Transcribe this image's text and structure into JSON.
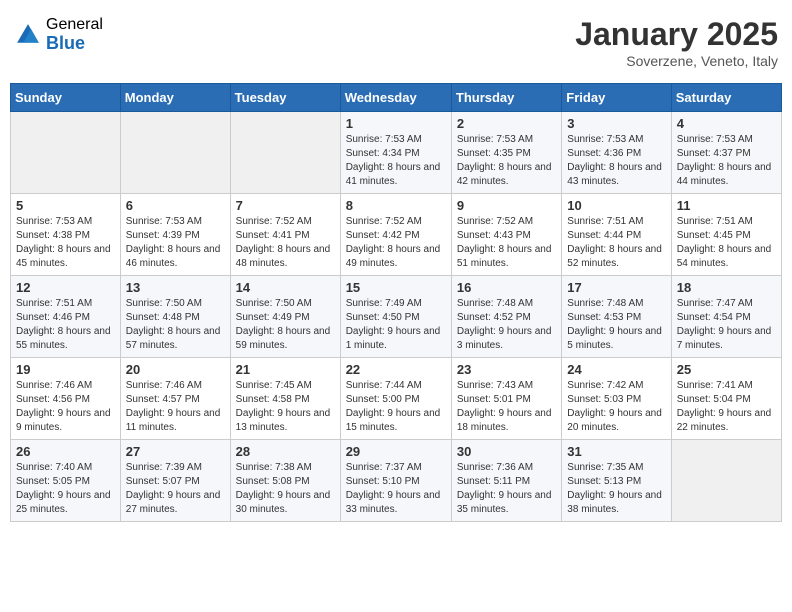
{
  "header": {
    "logo_general": "General",
    "logo_blue": "Blue",
    "month_title": "January 2025",
    "location": "Soverzene, Veneto, Italy"
  },
  "weekdays": [
    "Sunday",
    "Monday",
    "Tuesday",
    "Wednesday",
    "Thursday",
    "Friday",
    "Saturday"
  ],
  "weeks": [
    [
      {
        "day": "",
        "info": ""
      },
      {
        "day": "",
        "info": ""
      },
      {
        "day": "",
        "info": ""
      },
      {
        "day": "1",
        "info": "Sunrise: 7:53 AM\nSunset: 4:34 PM\nDaylight: 8 hours and 41 minutes."
      },
      {
        "day": "2",
        "info": "Sunrise: 7:53 AM\nSunset: 4:35 PM\nDaylight: 8 hours and 42 minutes."
      },
      {
        "day": "3",
        "info": "Sunrise: 7:53 AM\nSunset: 4:36 PM\nDaylight: 8 hours and 43 minutes."
      },
      {
        "day": "4",
        "info": "Sunrise: 7:53 AM\nSunset: 4:37 PM\nDaylight: 8 hours and 44 minutes."
      }
    ],
    [
      {
        "day": "5",
        "info": "Sunrise: 7:53 AM\nSunset: 4:38 PM\nDaylight: 8 hours and 45 minutes."
      },
      {
        "day": "6",
        "info": "Sunrise: 7:53 AM\nSunset: 4:39 PM\nDaylight: 8 hours and 46 minutes."
      },
      {
        "day": "7",
        "info": "Sunrise: 7:52 AM\nSunset: 4:41 PM\nDaylight: 8 hours and 48 minutes."
      },
      {
        "day": "8",
        "info": "Sunrise: 7:52 AM\nSunset: 4:42 PM\nDaylight: 8 hours and 49 minutes."
      },
      {
        "day": "9",
        "info": "Sunrise: 7:52 AM\nSunset: 4:43 PM\nDaylight: 8 hours and 51 minutes."
      },
      {
        "day": "10",
        "info": "Sunrise: 7:51 AM\nSunset: 4:44 PM\nDaylight: 8 hours and 52 minutes."
      },
      {
        "day": "11",
        "info": "Sunrise: 7:51 AM\nSunset: 4:45 PM\nDaylight: 8 hours and 54 minutes."
      }
    ],
    [
      {
        "day": "12",
        "info": "Sunrise: 7:51 AM\nSunset: 4:46 PM\nDaylight: 8 hours and 55 minutes."
      },
      {
        "day": "13",
        "info": "Sunrise: 7:50 AM\nSunset: 4:48 PM\nDaylight: 8 hours and 57 minutes."
      },
      {
        "day": "14",
        "info": "Sunrise: 7:50 AM\nSunset: 4:49 PM\nDaylight: 8 hours and 59 minutes."
      },
      {
        "day": "15",
        "info": "Sunrise: 7:49 AM\nSunset: 4:50 PM\nDaylight: 9 hours and 1 minute."
      },
      {
        "day": "16",
        "info": "Sunrise: 7:48 AM\nSunset: 4:52 PM\nDaylight: 9 hours and 3 minutes."
      },
      {
        "day": "17",
        "info": "Sunrise: 7:48 AM\nSunset: 4:53 PM\nDaylight: 9 hours and 5 minutes."
      },
      {
        "day": "18",
        "info": "Sunrise: 7:47 AM\nSunset: 4:54 PM\nDaylight: 9 hours and 7 minutes."
      }
    ],
    [
      {
        "day": "19",
        "info": "Sunrise: 7:46 AM\nSunset: 4:56 PM\nDaylight: 9 hours and 9 minutes."
      },
      {
        "day": "20",
        "info": "Sunrise: 7:46 AM\nSunset: 4:57 PM\nDaylight: 9 hours and 11 minutes."
      },
      {
        "day": "21",
        "info": "Sunrise: 7:45 AM\nSunset: 4:58 PM\nDaylight: 9 hours and 13 minutes."
      },
      {
        "day": "22",
        "info": "Sunrise: 7:44 AM\nSunset: 5:00 PM\nDaylight: 9 hours and 15 minutes."
      },
      {
        "day": "23",
        "info": "Sunrise: 7:43 AM\nSunset: 5:01 PM\nDaylight: 9 hours and 18 minutes."
      },
      {
        "day": "24",
        "info": "Sunrise: 7:42 AM\nSunset: 5:03 PM\nDaylight: 9 hours and 20 minutes."
      },
      {
        "day": "25",
        "info": "Sunrise: 7:41 AM\nSunset: 5:04 PM\nDaylight: 9 hours and 22 minutes."
      }
    ],
    [
      {
        "day": "26",
        "info": "Sunrise: 7:40 AM\nSunset: 5:05 PM\nDaylight: 9 hours and 25 minutes."
      },
      {
        "day": "27",
        "info": "Sunrise: 7:39 AM\nSunset: 5:07 PM\nDaylight: 9 hours and 27 minutes."
      },
      {
        "day": "28",
        "info": "Sunrise: 7:38 AM\nSunset: 5:08 PM\nDaylight: 9 hours and 30 minutes."
      },
      {
        "day": "29",
        "info": "Sunrise: 7:37 AM\nSunset: 5:10 PM\nDaylight: 9 hours and 33 minutes."
      },
      {
        "day": "30",
        "info": "Sunrise: 7:36 AM\nSunset: 5:11 PM\nDaylight: 9 hours and 35 minutes."
      },
      {
        "day": "31",
        "info": "Sunrise: 7:35 AM\nSunset: 5:13 PM\nDaylight: 9 hours and 38 minutes."
      },
      {
        "day": "",
        "info": ""
      }
    ]
  ]
}
